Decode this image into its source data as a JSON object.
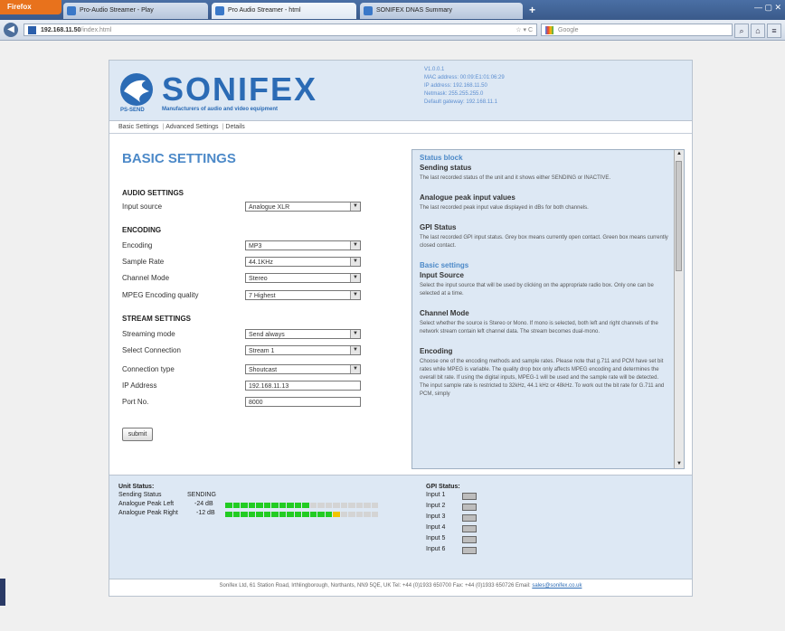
{
  "browser": {
    "app_button": "Firefox",
    "tabs": [
      {
        "label": "Pro-Audio Streamer - Play"
      },
      {
        "label": "Pro Audio Streamer - html"
      },
      {
        "label": "SONIFEX DNAS Summary"
      }
    ],
    "new_tab": "+",
    "url_host": "192.168.11.50",
    "url_path": "/index.html",
    "search_placeholder": "Google"
  },
  "header": {
    "brand": "SONIFEX",
    "product": "PS-SEND",
    "tagline": "Manufacturers of audio and video equipment",
    "device_info": [
      "V1.0.0.1",
      "MAC address: 00:09:E1:01:06:29",
      "IP address: 192.168.11.50",
      "Netmask: 255.255.255.0",
      "Default gateway: 192.168.11.1"
    ]
  },
  "nav": {
    "items": [
      "Basic Settings",
      "Advanced Settings",
      "Details"
    ]
  },
  "form": {
    "title": "BASIC SETTINGS",
    "audio_section": "AUDIO SETTINGS",
    "input_source_label": "Input source",
    "input_source_value": "Analogue XLR",
    "encoding_section": "ENCODING",
    "encoding_label": "Encoding",
    "encoding_value": "MP3",
    "sample_rate_label": "Sample Rate",
    "sample_rate_value": "44.1KHz",
    "channel_mode_label": "Channel Mode",
    "channel_mode_value": "Stereo",
    "mpeg_quality_label": "MPEG Encoding quality",
    "mpeg_quality_value": "7 Highest",
    "stream_section": "STREAM SETTINGS",
    "streaming_mode_label": "Streaming mode",
    "streaming_mode_value": "Send always",
    "select_connection_label": "Select Connection",
    "select_connection_value": "Stream 1",
    "connection_type_label": "Connection type",
    "connection_type_value": "Shoutcast",
    "ip_address_label": "IP Address",
    "ip_address_value": "192.168.11.13",
    "port_label": "Port No.",
    "port_value": "8000",
    "submit_label": "submit"
  },
  "help": {
    "sections": [
      {
        "heading": "Status block"
      },
      {
        "title": "Sending status",
        "text": "The last recorded status of the unit and it shows either SENDING or INACTIVE."
      },
      {
        "title": "Analogue peak input values",
        "text": "The last recorded peak input value displayed in dBs for both channels."
      },
      {
        "title": "GPI Status",
        "text": "The last recorded GPI input status. Grey box means currently open contact. Green box means currently closed contact."
      },
      {
        "heading": "Basic settings"
      },
      {
        "title": "Input Source",
        "text": "Select the input source that will be used by clicking on the appropriate radio box. Only one can be selected at a time."
      },
      {
        "title": "Channel Mode",
        "text": "Select whether the source is Stereo or Mono. If mono is selected, both left and right channels of the network stream contain left channel data. The stream becomes dual-mono."
      },
      {
        "title": "Encoding",
        "text": "Choose one of the encoding methods and sample rates. Please note that g.711 and PCM have set bit rates while MPEG is variable. The quality drop box only affects MPEG encoding and determines the overall bit rate. If using the digital inputs, MPEG-1 will be used and the sample rate will be detected. The input sample rate is restricted to 32kHz, 44.1 kHz or 48kHz. To work out the bit rate for G.711 and PCM, simply"
      }
    ]
  },
  "status": {
    "unit_title": "Unit Status:",
    "sending_label": "Sending Status",
    "sending_value": "SENDING",
    "peak_left_label": "Analogue Peak Left",
    "peak_left_value": "-24 dB",
    "peak_left_level": 0.55,
    "peak_right_label": "Analogue Peak Right",
    "peak_right_value": "-12 dB",
    "peak_right_level": 0.75,
    "gpi_title": "GPI Status:",
    "gpi_inputs": [
      "Input 1",
      "Input 2",
      "Input 3",
      "Input 4",
      "Input 5",
      "Input 6"
    ]
  },
  "footer": {
    "text": "Sonifex Ltd, 61 Station Road, Irthlingborough, Northants, NN9 5QE, UK Tel: +44 (0)1933 650700 Fax: +44 (0)1933 650726 Email:",
    "email": "sales@sonifex.co.uk"
  },
  "colors": {
    "accent": "#4c89c8",
    "brand": "#2b6bb5",
    "panel": "#dde8f4",
    "meter_green": "#22cc22",
    "meter_yellow": "#f2c400"
  }
}
